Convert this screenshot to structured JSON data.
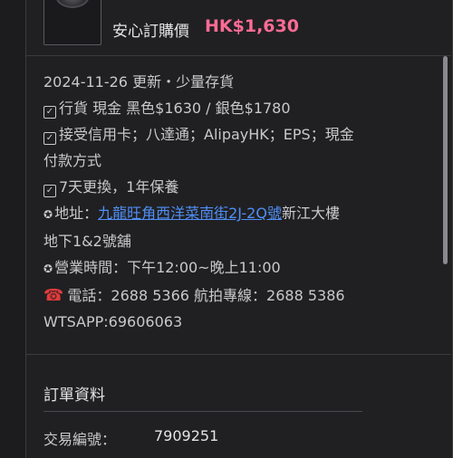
{
  "product": {
    "price_label": "安心訂購價",
    "price_value": "HK$1,630"
  },
  "details": {
    "updated": "2024-11-26 更新・少量存貨",
    "stock_line": "行貨 現金 黑色$1630 / 銀色$1780",
    "payment_line1": "接受信用卡；八達通；AlipayHK；EPS；現金",
    "payment_line2": "付款方式",
    "warranty_line": "7天更換，1年保養",
    "address_label": "地址：",
    "address_link": "九龍旺角西洋菜南街2J-2Q號",
    "address_rest": "新江大樓",
    "address_line2": "地下1&2號舖",
    "hours": "營業時間：下午12:00~晚上11:00",
    "phone": "電話：2688 5366 航拍專線：2688 5386",
    "whatsapp": "WTSAPP:69606063"
  },
  "order": {
    "section_title": "訂單資料",
    "txn_label": "交易編號：",
    "txn_value": "7909251"
  },
  "icons": {
    "checkbox": "checkbox-icon",
    "star": "star-icon",
    "phone": "telephone-icon"
  },
  "colors": {
    "price": "#ff6b95",
    "link": "#4f8ff7",
    "background": "#1c1c1e"
  }
}
